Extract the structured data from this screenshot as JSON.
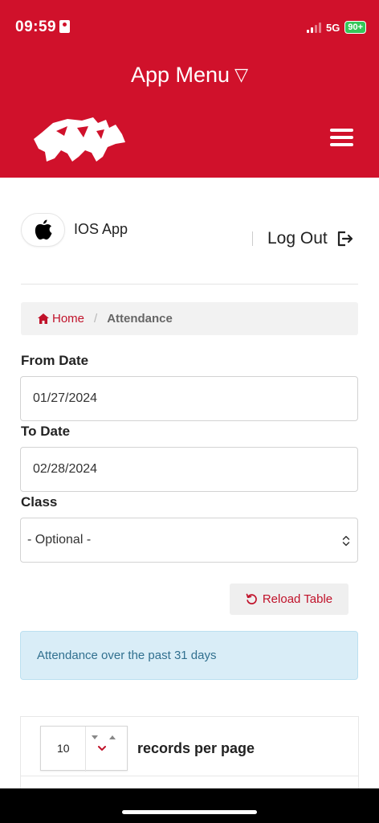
{
  "status_bar": {
    "time": "09:59",
    "network": "5G",
    "battery": "90+"
  },
  "header": {
    "menu_title": "App Menu",
    "menu_caret": "▽",
    "logo_icon": "rhino-logo",
    "menu_icon": "hamburger-icon",
    "background": "#d0112b"
  },
  "user": {
    "platform_icon": "apple-icon",
    "name": "IOS App",
    "logout_label": "Log Out"
  },
  "breadcrumb": {
    "home": "Home",
    "separator": "/",
    "current": "Attendance"
  },
  "form": {
    "from_date_label": "From Date",
    "from_date_value": "01/27/2024",
    "to_date_label": "To Date",
    "to_date_value": "02/28/2024",
    "class_label": "Class",
    "class_value": "- Optional -"
  },
  "reload_button": "Reload Table",
  "info_message": "Attendance over the past 31 days",
  "table": {
    "records_per_page_value": "10",
    "records_per_page_label": "records per page"
  },
  "colors": {
    "accent": "#c0122a",
    "info_bg": "#d9edf7",
    "info_text": "#31708f"
  }
}
